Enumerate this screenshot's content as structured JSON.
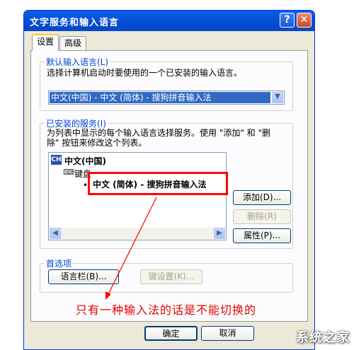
{
  "window": {
    "title": "文字服务和输入语言",
    "help_glyph": "?",
    "close_glyph": "✕"
  },
  "tabs": [
    {
      "label": "设置"
    },
    {
      "label": "高级"
    }
  ],
  "default_lang": {
    "legend": "默认输入语言(L)",
    "desc": "选择计算机启动时要使用的一个已安装的输入语言。",
    "selected": "中文(中国) - 中文 (简体) - 搜狗拼音输入法"
  },
  "services": {
    "legend": "已安装的服务(I)",
    "desc1": "为列表中显示的每个输入语言选择服务。使用 \"添加\" 和 \"删",
    "desc2": "除\" 按钮来修改这个列表。",
    "tree": {
      "lang_icon": "CH",
      "lang": "中文(中国)",
      "category": "键盘",
      "ime": "中文 (简体) - 搜狗拼音输入法"
    },
    "add_label": "添加(D)...",
    "remove_label": "删除(R)",
    "props_label": "属性(P)..."
  },
  "prefs": {
    "legend": "首选项",
    "langbar_label": "语言栏(B)...",
    "keys_label": "键设置(K)..."
  },
  "footer": {
    "ok_label": "确定",
    "cancel_label": "取消"
  },
  "annotation": {
    "note": "只有一种输入法的话是不能切换的"
  },
  "watermark": {
    "text": "系统之家"
  },
  "colors": {
    "titlebar": "#0752d8",
    "accent": "#0046d5",
    "highlight": "#316ac5",
    "annotation": "#ff0000"
  }
}
